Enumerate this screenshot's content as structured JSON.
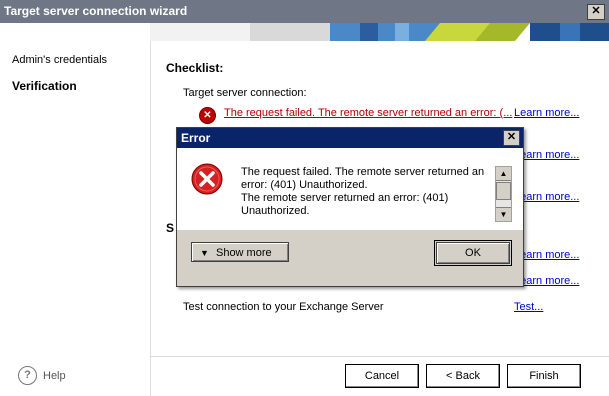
{
  "wizard": {
    "title": "Target server connection wizard",
    "close_glyph": "✕"
  },
  "sidebar": {
    "items": [
      {
        "label": "Admin's credentials"
      },
      {
        "label": "Verification"
      }
    ],
    "help_label": "Help",
    "help_glyph": "?"
  },
  "main": {
    "checklist_title": "Checklist:",
    "target_label": "Target server connection:",
    "error_line": "The request failed. The remote server returned an error: (...",
    "learn_more": "Learn more...",
    "section_s": "S",
    "test_label": "Test connection to your Exchange Server",
    "test_link": "Test..."
  },
  "footer": {
    "cancel": "Cancel",
    "back": "< Back",
    "finish": "Finish"
  },
  "dialog": {
    "title": "Error",
    "close_glyph": "✕",
    "message_1": "The request failed. The remote server returned an",
    "message_2": "error: (401) Unauthorized.",
    "message_3": "The remote server returned an error: (401)",
    "message_4": "Unauthorized.",
    "show_more": "Show more",
    "show_more_glyph": "▼",
    "ok": "OK",
    "scroll_up_glyph": "▲",
    "scroll_down_glyph": "▼"
  },
  "colors": {
    "title_bar": "#6f7787",
    "dialog_title_bar": "#0a246a",
    "link": "#0000cc",
    "error": "#c00000"
  }
}
